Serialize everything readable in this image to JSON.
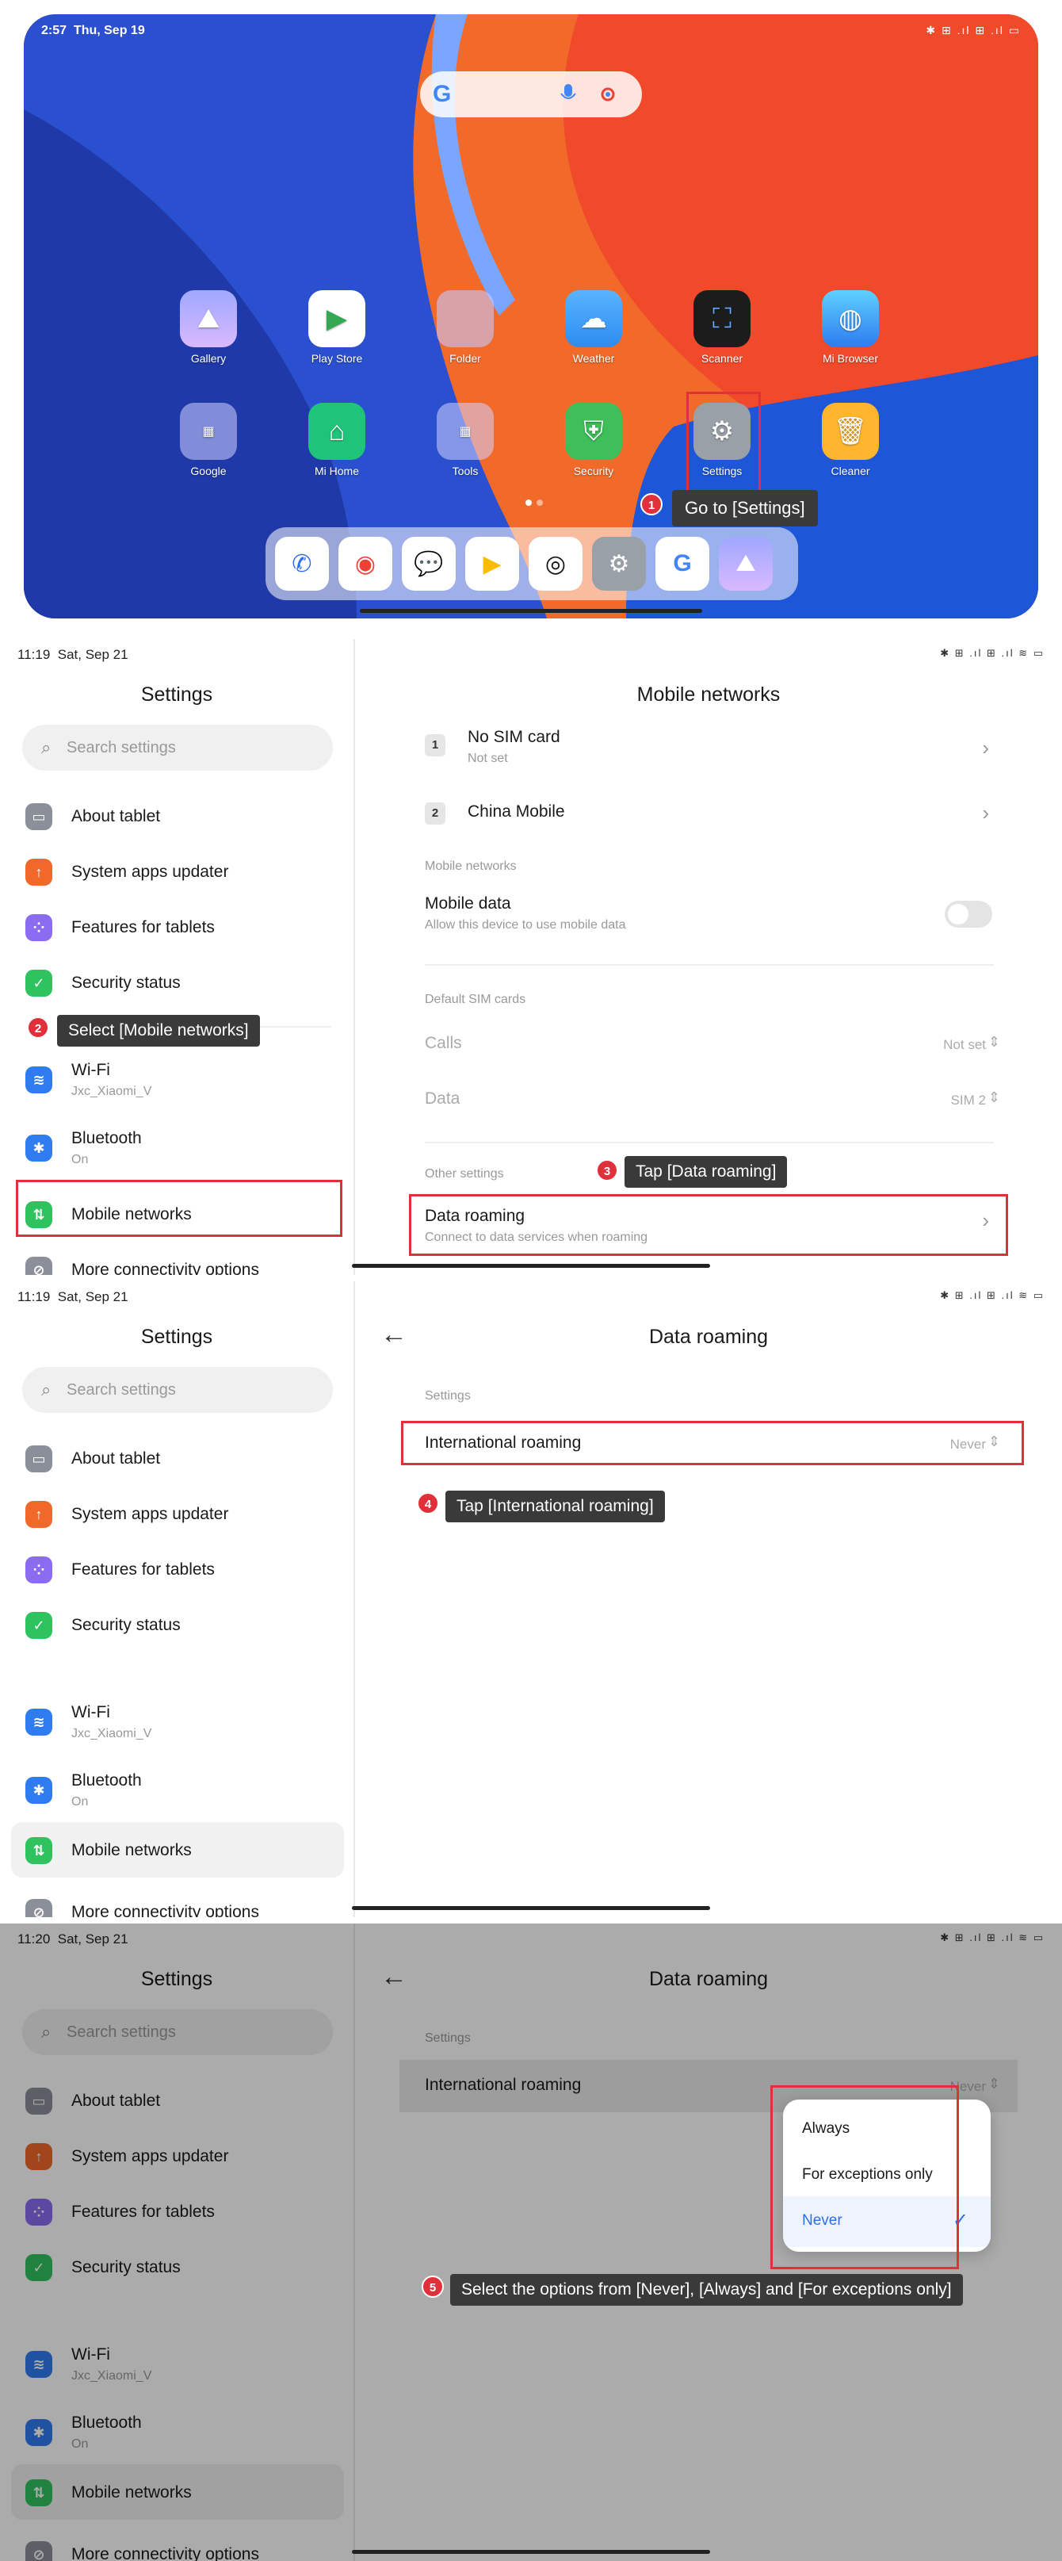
{
  "home": {
    "status_time": "2:57",
    "status_date": "Thu, Sep 19",
    "status_icons": "✱ ⊞ .ıl ⊞ .ıl ▭",
    "apps_row1": [
      "Gallery",
      "Play Store",
      "Folder",
      "Weather",
      "Scanner",
      "Mi Browser"
    ],
    "apps_row2": [
      "Google",
      "Mi Home",
      "Tools",
      "Security",
      "Settings",
      "Cleaner"
    ],
    "callout_number": "1",
    "callout": "Go to [Settings]"
  },
  "settings": {
    "status_time": "11:19",
    "status_time_last": "11:20",
    "status_date": "Sat, Sep 21",
    "status_icons": "✱ ⊞ .ıl ⊞ .ıl ≋ ▭",
    "title": "Settings",
    "search_placeholder": "Search settings",
    "items": [
      {
        "label": "About tablet"
      },
      {
        "label": "System apps updater"
      },
      {
        "label": "Features for tablets"
      },
      {
        "label": "Security status"
      },
      {
        "label": "Wi-Fi",
        "sub": "Jxc_Xiaomi_V"
      },
      {
        "label": "Bluetooth",
        "sub": "On"
      },
      {
        "label": "Mobile networks"
      },
      {
        "label": "More connectivity options"
      }
    ]
  },
  "mobile_networks": {
    "title": "Mobile networks",
    "sim1_num": "1",
    "sim1_title": "No SIM card",
    "sim1_sub": "Not set",
    "sim2_num": "2",
    "sim2_title": "China Mobile",
    "section_mobile": "Mobile networks",
    "mobile_data": "Mobile data",
    "mobile_data_sub": "Allow this device to use mobile data",
    "section_default": "Default SIM cards",
    "calls": "Calls",
    "calls_value": "Not set",
    "data": "Data",
    "data_value": "SIM 2",
    "section_other": "Other settings",
    "data_roaming": "Data roaming",
    "data_roaming_sub": "Connect to data services when roaming",
    "callout2_number": "2",
    "callout2": "Select [Mobile networks]",
    "callout3_number": "3",
    "callout3": "Tap [Data roaming]"
  },
  "data_roaming": {
    "title": "Data roaming",
    "section": "Settings",
    "intl_roaming": "International roaming",
    "intl_value": "Never",
    "callout4_number": "4",
    "callout4": "Tap [International roaming]",
    "options": [
      "Always",
      "For exceptions only",
      "Never"
    ],
    "selected": "Never",
    "callout5_number": "5",
    "callout5": "Select the options from [Never], [Always] and [For exceptions only]"
  },
  "colors": {
    "highlight": "#e0303a",
    "selected_option": "#2b6ff0"
  }
}
